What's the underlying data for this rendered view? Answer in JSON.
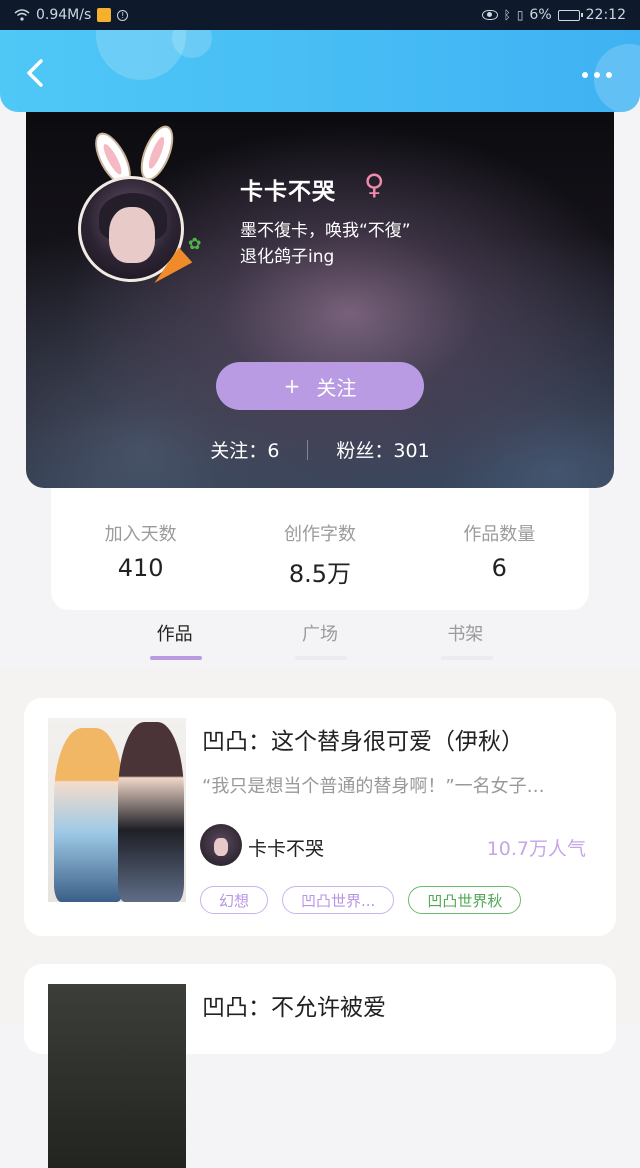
{
  "status_bar": {
    "speed": "0.94M/s",
    "battery": "6%",
    "time": "22:12"
  },
  "profile": {
    "nickname": "卡卡不哭",
    "gender_symbol": "♀",
    "bio": "墨不復卡，唤我“不復”\n退化鸽子ing",
    "follow_plus": "+",
    "follow_label": "关注",
    "following_label": "关注：",
    "following_count": "6",
    "fans_label": "粉丝：",
    "fans_count": "301"
  },
  "summary": [
    {
      "label": "加入天数",
      "value": "410"
    },
    {
      "label": "创作字数",
      "value": "8.5万"
    },
    {
      "label": "作品数量",
      "value": "6"
    }
  ],
  "tabs": [
    {
      "label": "作品",
      "active": true
    },
    {
      "label": "广场",
      "active": false
    },
    {
      "label": "书架",
      "active": false
    }
  ],
  "works": [
    {
      "title": "凹凸：这个替身很可爱（伊秋）",
      "description": "“我只是想当个普通的替身啊！”一名女子…",
      "author": "卡卡不哭",
      "popularity": "10.7万人气",
      "tags": [
        "幻想",
        "凹凸世界...",
        "凹凸世界秋"
      ]
    },
    {
      "title": "凹凸：不允许被爱"
    }
  ],
  "colors": {
    "accent": "#b89be2",
    "header": "#3fb2f3",
    "tag_purple": "#b895e4",
    "tag_green": "#4fa854"
  }
}
